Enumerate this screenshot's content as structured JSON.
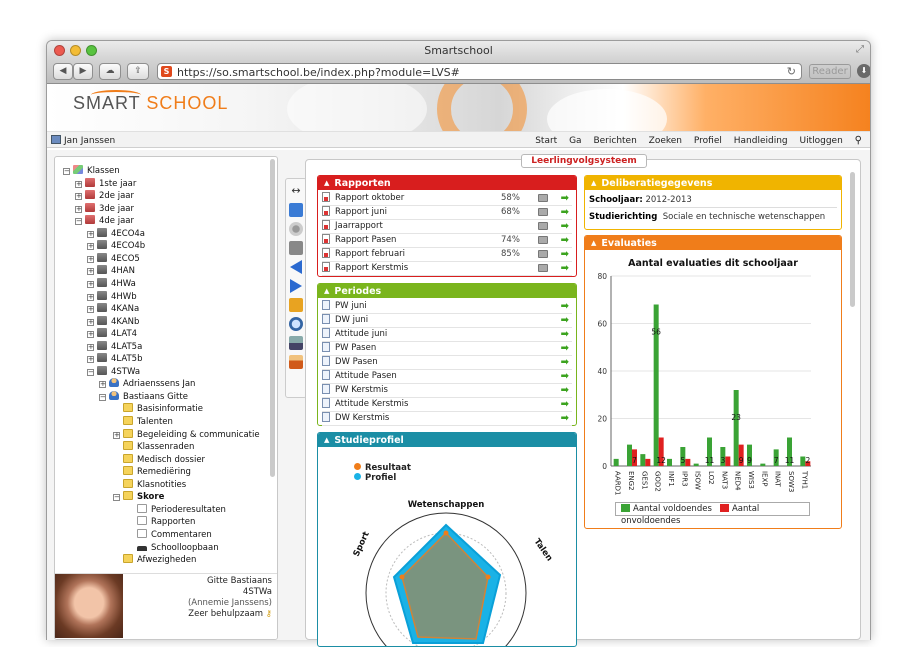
{
  "browser": {
    "window_title": "Smartschool",
    "url": "https://so.smartschool.be/index.php?module=LVS#",
    "reader_label": "Reader"
  },
  "logo": {
    "text1": "SMART",
    "text2": "SCHOOL"
  },
  "menubar": {
    "user": "Jan Janssen",
    "items": [
      "Start",
      "Ga",
      "Berichten",
      "Zoeken",
      "Profiel",
      "Handleiding",
      "Uitloggen"
    ]
  },
  "module_tab": "Leerlingvolgsysteem",
  "tree": {
    "root": "Klassen",
    "years": [
      "1ste jaar",
      "2de jaar",
      "3de jaar",
      "4de jaar"
    ],
    "classes": [
      "4ECO4a",
      "4ECO4b",
      "4ECO5",
      "4HAN",
      "4HWa",
      "4HWb",
      "4KANa",
      "4KANb",
      "4LAT4",
      "4LAT5a",
      "4LAT5b",
      "4STWa"
    ],
    "students": [
      "Adriaenssens Jan",
      "Bastiaans Gitte"
    ],
    "student_items": [
      "Basisinformatie",
      "Talenten",
      "Begeleiding & communicatie",
      "Klassenraden",
      "Medisch dossier",
      "Remediëring",
      "Klasnotities",
      "Skore"
    ],
    "skore_items": [
      "Perioderesultaten",
      "Rapporten",
      "Commentaren",
      "Schoolloopbaan"
    ],
    "after": [
      "Afwezigheden"
    ]
  },
  "profile": {
    "name": "Gitte Bastiaans",
    "class": "4STWa",
    "parent": "(Annemie Janssens)",
    "note": "Zeer behulpzaam"
  },
  "rapporten": {
    "title": "Rapporten",
    "color": "#d81e1e",
    "items": [
      {
        "label": "Rapport oktober",
        "pct": "58%"
      },
      {
        "label": "Rapport juni",
        "pct": "68%"
      },
      {
        "label": "Jaarrapport",
        "pct": ""
      },
      {
        "label": "Rapport Pasen",
        "pct": "74%"
      },
      {
        "label": "Rapport februari",
        "pct": "85%"
      },
      {
        "label": "Rapport Kerstmis",
        "pct": ""
      }
    ]
  },
  "periodes": {
    "title": "Periodes",
    "color": "#7ab51d",
    "items": [
      "PW juni",
      "DW juni",
      "Attitude juni",
      "PW Pasen",
      "DW Pasen",
      "Attitude Pasen",
      "PW Kerstmis",
      "Attitude Kerstmis",
      "DW Kerstmis"
    ]
  },
  "studieprofiel": {
    "title": "Studieprofiel",
    "color": "#1b8ea5",
    "legend": [
      "Resultaat",
      "Profiel"
    ],
    "axes": [
      "Wetenschappen",
      "Talen",
      "Sport"
    ]
  },
  "deliberatie": {
    "title": "Deliberatiegegevens",
    "color": "#f0b400",
    "schooljaar_label": "Schooljaar:",
    "schooljaar_value": "2012-2013",
    "studierichting_label": "Studierichting",
    "studierichting_value": "Sociale en technische wetenschappen"
  },
  "evaluaties": {
    "title": "Evaluaties",
    "color": "#f07d1a"
  },
  "chart_data": {
    "type": "bar",
    "title": "Aantal evaluaties dit schooljaar",
    "categories": [
      "AARD1",
      "ENG2",
      "GES1",
      "GOD2",
      "INF1",
      "IPR3",
      "ISOW",
      "LO2",
      "NAT3",
      "NED4",
      "WIS3",
      "IEXP",
      "INAT",
      "SOW3",
      "TYH1"
    ],
    "series": [
      {
        "name": "Aantal voldoendes",
        "color": "#3aa335",
        "values": [
          3,
          9,
          5,
          68,
          3,
          8,
          1,
          12,
          8,
          32,
          9,
          1,
          7,
          12,
          4
        ]
      },
      {
        "name": "Aantal onvoldoendes",
        "color": "#e02020",
        "values": [
          0,
          7,
          3,
          12,
          0,
          3,
          0,
          0,
          4,
          9,
          0,
          0,
          0,
          0,
          2
        ]
      }
    ],
    "data_labels": [
      {
        "category": "GOD2",
        "series": "Aantal voldoendes",
        "text": "56"
      },
      {
        "category": "NED4",
        "series": "Aantal voldoendes",
        "text": "23"
      },
      {
        "category": "ENG2",
        "series": "Aantal onvoldoendes",
        "text": "7"
      },
      {
        "category": "GOD2",
        "series": "Aantal onvoldoendes",
        "text": "12"
      },
      {
        "category": "IPR3",
        "series": "Aantal voldoendes",
        "text": "5"
      },
      {
        "category": "LO2",
        "series": "Aantal voldoendes",
        "text": "11"
      },
      {
        "category": "NAT3",
        "series": "Aantal voldoendes",
        "text": "3"
      },
      {
        "category": "NED4",
        "series": "Aantal onvoldoendes",
        "text": "9"
      },
      {
        "category": "WIS3",
        "series": "Aantal voldoendes",
        "text": "9"
      },
      {
        "category": "INAT",
        "series": "Aantal voldoendes",
        "text": "7"
      },
      {
        "category": "SOW3",
        "series": "Aantal voldoendes",
        "text": "11"
      },
      {
        "category": "TYH1",
        "series": "Aantal onvoldoendes",
        "text": "2"
      }
    ],
    "ylim": [
      0,
      80
    ],
    "yticks": [
      0,
      20,
      40,
      60,
      80
    ],
    "legend_position": "bottom"
  }
}
